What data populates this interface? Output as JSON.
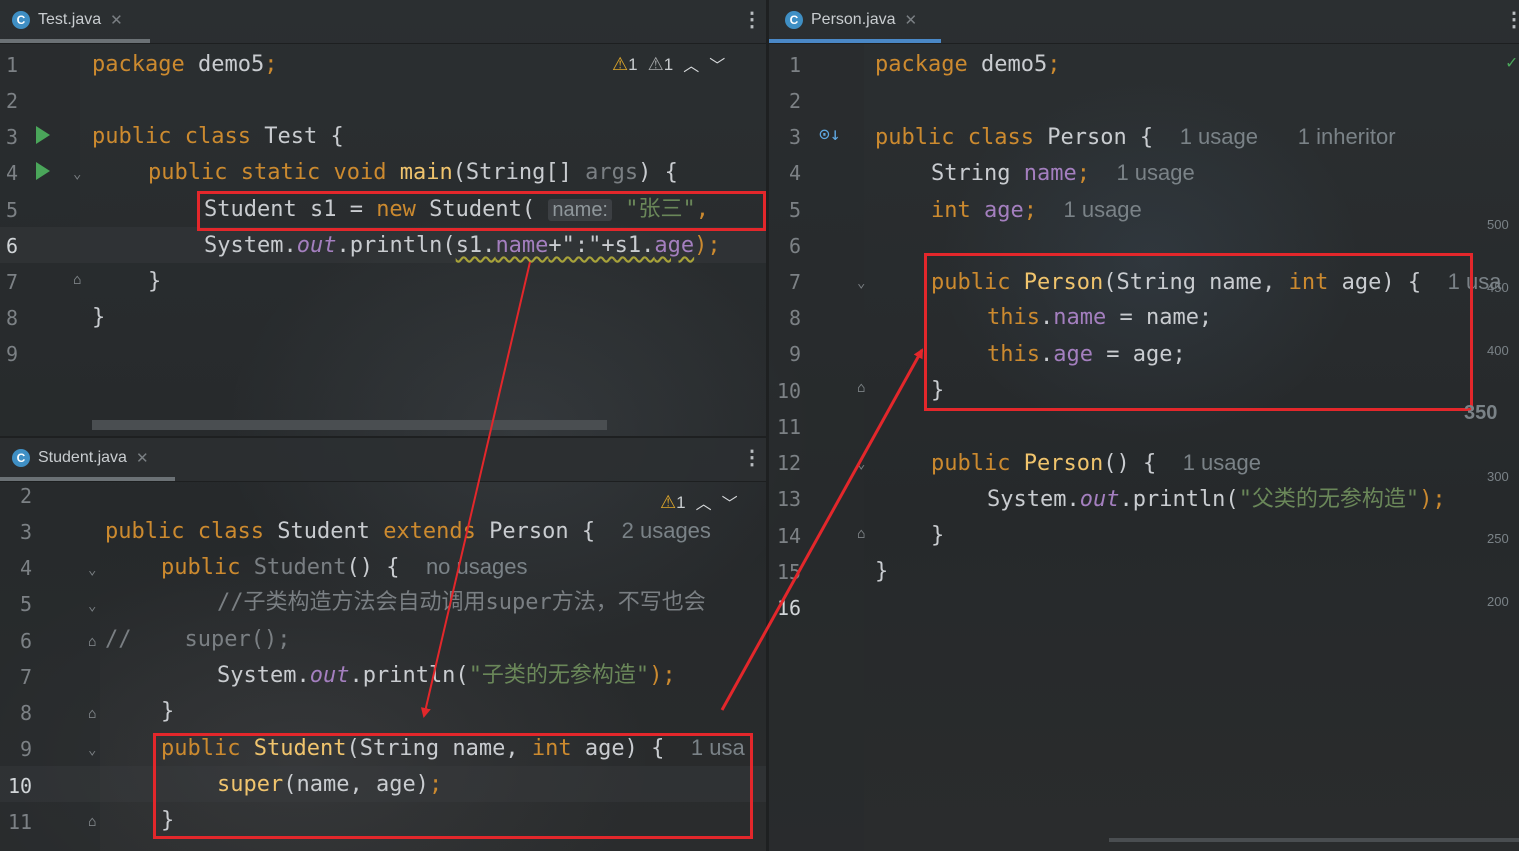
{
  "test_tab": {
    "label": "Test.java",
    "close": "✕",
    "warn1": "1",
    "warn2": "1"
  },
  "person_tab": {
    "label": "Person.java",
    "close": "✕",
    "status": "✓"
  },
  "student_tab": {
    "label": "Student.java",
    "close": "✕",
    "warn": "1"
  },
  "test_lines": [
    {
      "n": "1",
      "t": "package demo5;"
    },
    {
      "n": "2",
      "t": ""
    },
    {
      "n": "3",
      "t": "public class Test {"
    },
    {
      "n": "4",
      "t": "public static void main(String[] args) {"
    },
    {
      "n": "5",
      "t": "Student s1 = new Student( name: \"张三\", "
    },
    {
      "n": "6",
      "t": "System.out.println(s1.name+\":\"+s1.age);"
    },
    {
      "n": "7",
      "t": "}"
    },
    {
      "n": "8",
      "t": "}"
    },
    {
      "n": "9",
      "t": ""
    }
  ],
  "student_lines": [
    {
      "n": "2"
    },
    {
      "n": "3"
    },
    {
      "n": "4"
    },
    {
      "n": "5"
    },
    {
      "n": "6"
    },
    {
      "n": "7"
    },
    {
      "n": "8"
    },
    {
      "n": "9"
    },
    {
      "n": "10"
    },
    {
      "n": "11"
    }
  ],
  "person_lines": [
    {
      "n": "1"
    },
    {
      "n": "2"
    },
    {
      "n": "3"
    },
    {
      "n": "4"
    },
    {
      "n": "5"
    },
    {
      "n": "6"
    },
    {
      "n": "7"
    },
    {
      "n": "8"
    },
    {
      "n": "9"
    },
    {
      "n": "10"
    },
    {
      "n": "11"
    },
    {
      "n": "12"
    },
    {
      "n": "13"
    },
    {
      "n": "14"
    },
    {
      "n": "15"
    },
    {
      "n": "16"
    }
  ],
  "code": {
    "pkg_kw": "package",
    "pkg_name": " demo5",
    "semi": ";",
    "public": "public",
    "class": "class",
    "static": "static",
    "void": "void",
    "new": "new",
    "int": "int",
    "extends": "extends",
    "this": "this",
    "super": "super",
    "test_cls": "Test",
    "main": "main",
    "string_args": "(String[] ",
    "args": "args",
    "paren_brace": ") {",
    "student_decl": "Student s1 = ",
    "student_ctor": " Student(",
    "name_hint": "name:",
    "zhangsan": "\"张三\"",
    "comma": ", ",
    "sysout_a": "System.",
    "out": "out",
    "println": ".println(",
    "s1": "s1.",
    "name": "name",
    "plus_str": "+\":\"+",
    "s1b": "s1.",
    "age": "age",
    "close_semi": ");",
    "student_cls": " Student ",
    "person": " Person {",
    "usages2": "2 usages",
    "student_ctor_name": "Student",
    "empty_ctor": "() {",
    "no_usages": "no usages",
    "comment1": "//子类构造方法会自动调用super方法，不写也会",
    "comment2a": "//",
    "comment2b": "super();",
    "str_child": "\"子类的无参构造\"",
    "ctor_student_args": "(String name, ",
    "ctor_age": " age) {",
    "one_usa": "1 usa",
    "super_args": "(name, age)",
    "person_cls": " Person {",
    "one_usage": "1 usage",
    "one_inheritor": "1 inheritor",
    "string_type": "String ",
    "int_type": "int ",
    "person_ctor": "Person",
    "person_ctor_args": "(String name, ",
    "person_ctor_age": " age) {",
    "one_usa_b": "1 usa",
    "assign_name": " = name;",
    "assign_age": " = age;",
    "str_parent": "\"父类的无参构造\"",
    "brace_open": "{",
    "brace_close": "}",
    "dot": "."
  },
  "scale_ticks": [
    "500",
    "450",
    "400",
    "350",
    "300",
    "250",
    "200"
  ]
}
